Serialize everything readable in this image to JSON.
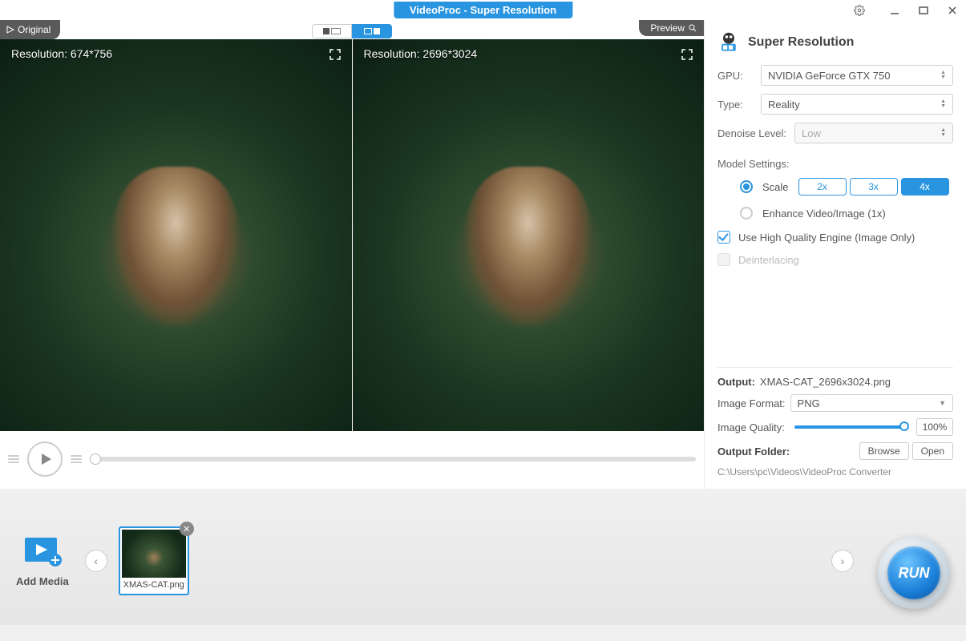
{
  "titlebar": {
    "title": "VideoProc  -  Super Resolution"
  },
  "preview": {
    "original_tab": "Original",
    "preview_tab": "Preview",
    "left_res": "Resolution: 674*756",
    "right_res": "Resolution: 2696*3024"
  },
  "settings": {
    "title": "Super Resolution",
    "gpu_label": "GPU:",
    "gpu_value": "NVIDIA GeForce GTX 750",
    "type_label": "Type:",
    "type_value": "Reality",
    "denoise_label": "Denoise Level:",
    "denoise_value": "Low",
    "model_label": "Model Settings:",
    "scale_label": "Scale",
    "scale_2x": "2x",
    "scale_3x": "3x",
    "scale_4x": "4x",
    "enhance_label": "Enhance Video/Image (1x)",
    "hq_label": "Use High Quality Engine (Image Only)",
    "deint_label": "Deinterlacing"
  },
  "output": {
    "label": "Output:",
    "filename": "XMAS-CAT_2696x3024.png",
    "format_label": "Image Format:",
    "format_value": "PNG",
    "quality_label": "Image Quality:",
    "quality_value": "100%",
    "folder_label": "Output Folder:",
    "browse": "Browse",
    "open": "Open",
    "path": "C:\\Users\\pc\\Videos\\VideoProc Converter"
  },
  "bottom": {
    "add_media": "Add Media",
    "thumb_name": "XMAS-CAT.png",
    "run": "RUN"
  }
}
